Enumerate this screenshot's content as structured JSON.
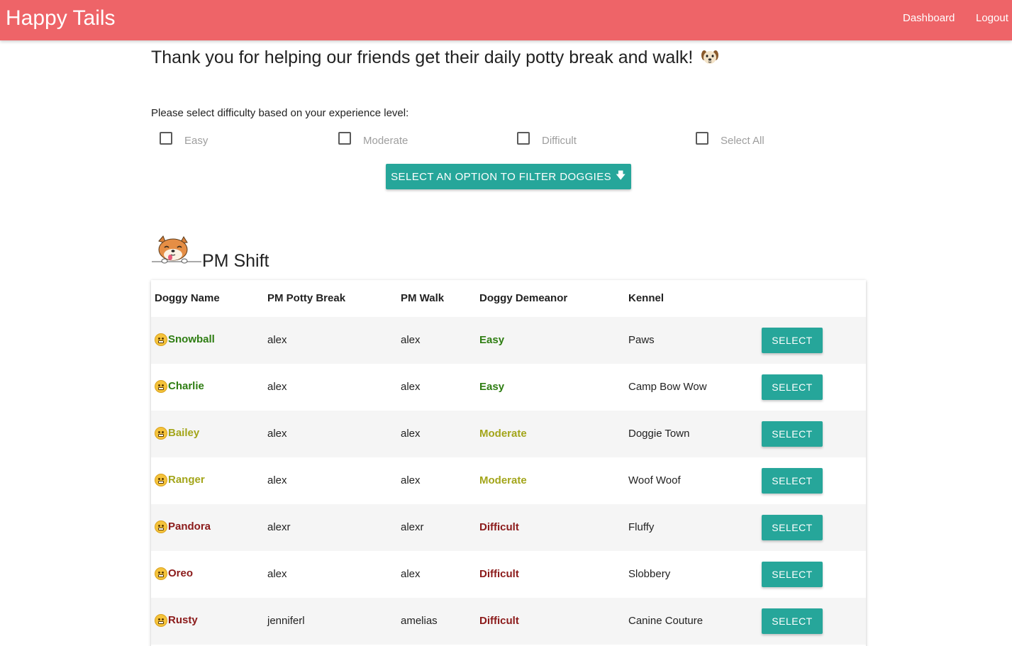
{
  "header": {
    "brand": "Happy Tails",
    "nav": {
      "dashboard": "Dashboard",
      "logout": "Logout"
    },
    "background_color": "#ee6468"
  },
  "intro": {
    "heading": "Thank you for helping our friends get their daily potty break and walk!",
    "heading_emoji": "dog-face-icon",
    "difficulty_prompt": "Please select difficulty based on your experience level:"
  },
  "difficulty_options": [
    {
      "label": "Easy",
      "checked": false
    },
    {
      "label": "Moderate",
      "checked": false
    },
    {
      "label": "Difficult",
      "checked": false
    },
    {
      "label": "Select All",
      "checked": false
    }
  ],
  "filter_button": {
    "label": "SELECT AN OPTION TO FILTER DOGGIES",
    "icon": "arrow-down-icon"
  },
  "shift": {
    "title": "PM Shift",
    "icon": "peeking-shiba-icon",
    "columns": [
      "Doggy Name",
      "PM Potty Break",
      "PM Walk",
      "Doggy Demeanor",
      "Kennel"
    ],
    "select_label": "SELECT",
    "rows": [
      {
        "name": "Snowball",
        "potty": "alex",
        "walk": "alex",
        "demeanor": "Easy",
        "kennel": "Paws"
      },
      {
        "name": "Charlie",
        "potty": "alex",
        "walk": "alex",
        "demeanor": "Easy",
        "kennel": "Camp Bow Wow"
      },
      {
        "name": "Bailey",
        "potty": "alex",
        "walk": "alex",
        "demeanor": "Moderate",
        "kennel": "Doggie Town"
      },
      {
        "name": "Ranger",
        "potty": "alex",
        "walk": "alex",
        "demeanor": "Moderate",
        "kennel": "Woof Woof"
      },
      {
        "name": "Pandora",
        "potty": "alexr",
        "walk": "alexr",
        "demeanor": "Difficult",
        "kennel": "Fluffy"
      },
      {
        "name": "Oreo",
        "potty": "alex",
        "walk": "alex",
        "demeanor": "Difficult",
        "kennel": "Slobbery"
      },
      {
        "name": "Rusty",
        "potty": "jenniferl",
        "walk": "amelias",
        "demeanor": "Difficult",
        "kennel": "Canine Couture"
      }
    ]
  },
  "colors": {
    "accent": "#26a69a",
    "easy": "#2e7d12",
    "moderate": "#a3a51a",
    "difficult": "#8b1a1a"
  }
}
